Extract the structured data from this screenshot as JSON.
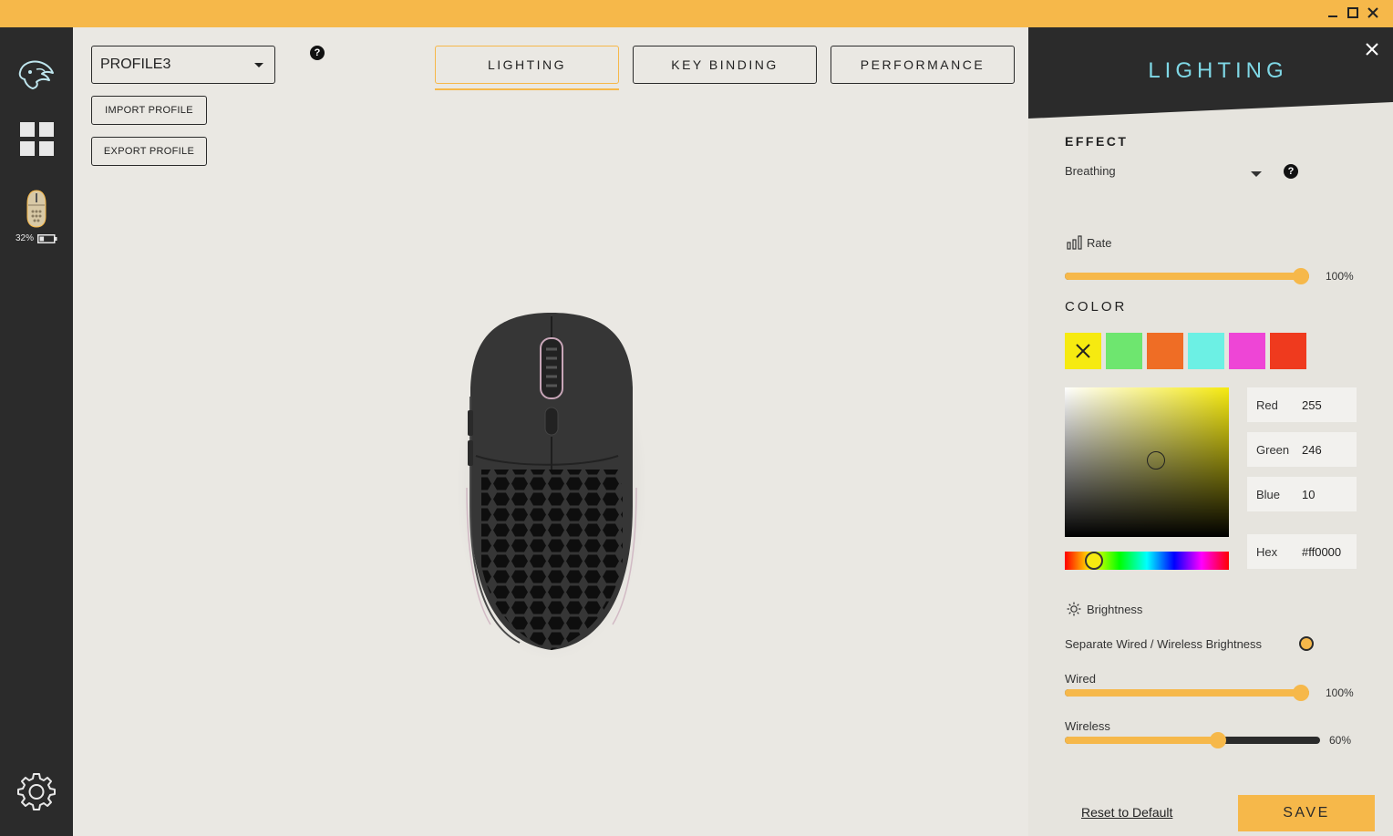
{
  "window": {
    "minimize_icon": "minimize-icon",
    "maximize_icon": "maximize-icon",
    "close_icon": "close-icon",
    "accent_color": "#f6b84a"
  },
  "sidebar": {
    "logo_icon": "glorious-ghost-icon",
    "dashboard_icon": "grid-icon",
    "device": {
      "icon": "mouse-icon",
      "battery_percent": "32%",
      "battery_icon": "battery-icon",
      "battery_level": 0.32
    },
    "settings_icon": "gear-icon"
  },
  "main": {
    "profile": {
      "selected": "PROFILE3"
    },
    "import_label": "IMPORT PROFILE",
    "export_label": "EXPORT PROFILE",
    "help_label": "?",
    "tabs": [
      {
        "label": "LIGHTING",
        "active": true
      },
      {
        "label": "KEY BINDING",
        "active": false
      },
      {
        "label": "PERFORMANCE",
        "active": false
      }
    ],
    "device_image": "mouse-device-image"
  },
  "panel": {
    "title": "LIGHTING",
    "close_icon": "close-icon",
    "effect": {
      "title": "EFFECT",
      "selected": "Breathing",
      "help_label": "?"
    },
    "rate": {
      "label": "Rate",
      "icon": "bars-icon",
      "value": "100%",
      "level": 1.0
    },
    "color": {
      "title": "COLOR",
      "swatches": [
        "#f6ea10",
        "#6ee66f",
        "#ef6d25",
        "#6cf0e4",
        "#ee45d6",
        "#ef3a1e"
      ],
      "selected_swatch_index": 0,
      "fields": {
        "red_label": "Red",
        "red_value": "255",
        "green_label": "Green",
        "green_value": "246",
        "blue_label": "Blue",
        "blue_value": "10",
        "hex_label": "Hex",
        "hex_value": "#ff0000"
      }
    },
    "brightness": {
      "label": "Brightness",
      "icon": "sun-icon",
      "separate_label": "Separate Wired / Wireless Brightness",
      "wired_label": "Wired",
      "wired_value": "100%",
      "wired_level": 1.0,
      "wireless_label": "Wireless",
      "wireless_value": "60%",
      "wireless_level": 0.6
    },
    "reset_label": "Reset to Default",
    "save_label": "SAVE"
  }
}
